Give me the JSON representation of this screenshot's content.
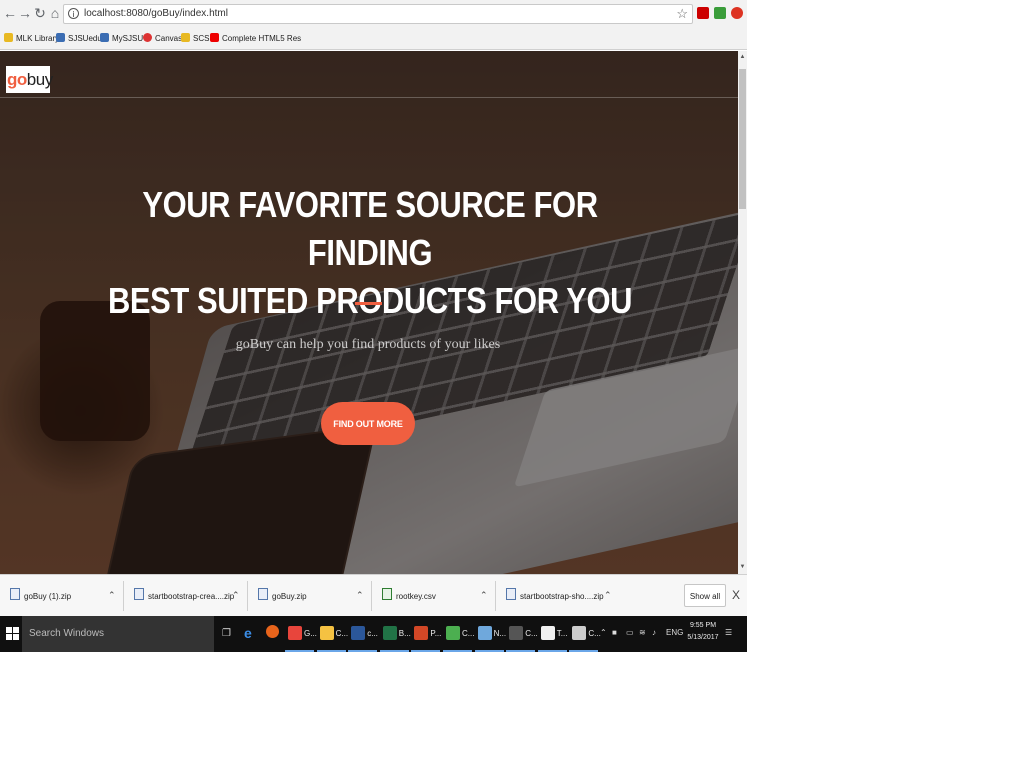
{
  "browser": {
    "url": "localhost:8080/goBuy/index.html",
    "bookmarks": [
      "MLK Library",
      "SJSUedu",
      "MySJSU",
      "Canvas",
      "SCS",
      "Complete HTML5 Res"
    ]
  },
  "page": {
    "logo_go": "go",
    "logo_buy": "buy",
    "hero_line1": "YOUR FAVORITE SOURCE FOR FINDING",
    "hero_line2": "BEST SUITED PRODUCTS FOR YOU",
    "subtitle": "goBuy can help you find products of your likes",
    "cta_label": "FIND OUT MORE",
    "accent_color": "#f05f40"
  },
  "downloads": {
    "items": [
      "goBuy (1).zip",
      "startbootstrap-crea....zip",
      "goBuy.zip",
      "rootkey.csv",
      "startbootstrap-sho....zip"
    ],
    "show_all": "Show all",
    "close": "X"
  },
  "taskbar": {
    "search_placeholder": "Search Windows",
    "apps": [
      {
        "label": "G...",
        "icon": "chrome-icon",
        "color": "#e8453c"
      },
      {
        "label": "C...",
        "icon": "folder-icon",
        "color": "#f5c242"
      },
      {
        "label": "c...",
        "icon": "word-icon",
        "color": "#2b579a"
      },
      {
        "label": "B...",
        "icon": "excel-icon",
        "color": "#217346"
      },
      {
        "label": "P...",
        "icon": "powerpoint-icon",
        "color": "#d24726"
      },
      {
        "label": "C...",
        "icon": "app-icon",
        "color": "#4caf50"
      },
      {
        "label": "N...",
        "icon": "app-icon",
        "color": "#6fa8dc"
      },
      {
        "label": "C...",
        "icon": "terminal-icon",
        "color": "#555555"
      },
      {
        "label": "T...",
        "icon": "app-icon",
        "color": "#f0f0f0"
      },
      {
        "label": "C...",
        "icon": "app-icon",
        "color": "#cccccc"
      }
    ],
    "language": "ENG",
    "time": "9:55 PM",
    "date": "5/13/2017"
  }
}
